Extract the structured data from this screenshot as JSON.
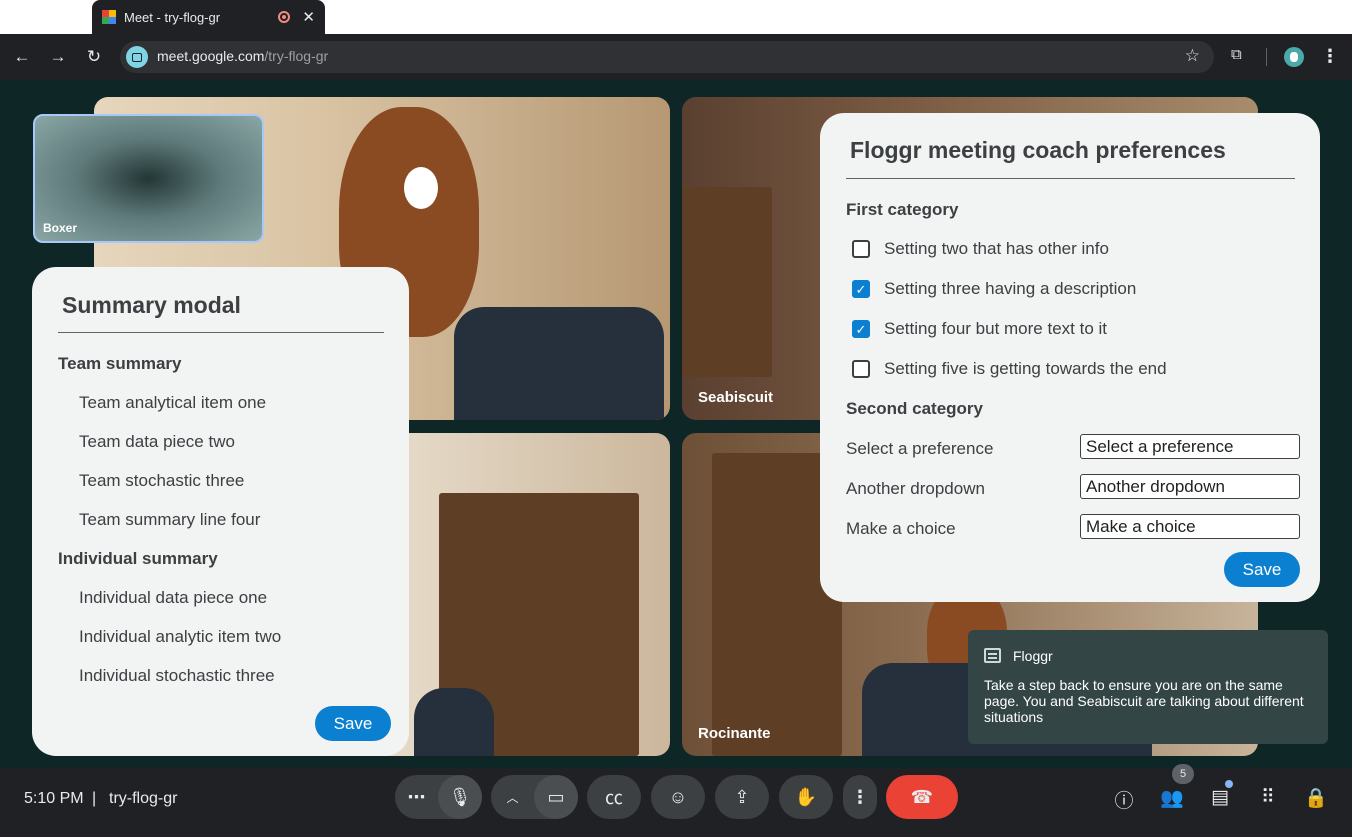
{
  "browser": {
    "tab_title": "Meet - try-flog-gr",
    "url_host": "meet.google.com",
    "url_path": "/try-flog-gr",
    "icons": [
      "back-icon",
      "forward-icon",
      "reload-icon",
      "site-info-icon",
      "bookmark-star-icon",
      "extensions-icon",
      "profile-avatar",
      "more-icon",
      "recording-icon",
      "close-icon"
    ]
  },
  "participants": {
    "self_name": "Boxer",
    "tile_top_right": "Seabiscuit",
    "tile_bottom_right": "Rocinante"
  },
  "summary_modal": {
    "title": "Summary modal",
    "team_heading": "Team summary",
    "team_items": [
      "Team analytical item one",
      "Team data piece two",
      "Team stochastic three",
      "Team summary line four"
    ],
    "individual_heading": "Individual summary",
    "individual_items": [
      "Individual data piece one",
      "Individual analytic item two",
      "Individual stochastic three"
    ],
    "save_label": "Save"
  },
  "prefs_modal": {
    "title": "Floggr meeting coach preferences",
    "first_category": "First category",
    "settings": [
      {
        "label": "Setting two that has other info",
        "checked": false
      },
      {
        "label": "Setting three having a description",
        "checked": true
      },
      {
        "label": "Setting four but more text to it",
        "checked": true
      },
      {
        "label": "Setting five is getting towards the end",
        "checked": false
      }
    ],
    "second_category": "Second category",
    "selects": [
      {
        "label": "Select a preference",
        "value": "Select a preference"
      },
      {
        "label": "Another dropdown",
        "value": "Another dropdown"
      },
      {
        "label": "Make a choice",
        "value": "Make a choice"
      }
    ],
    "save_label": "Save",
    "accent": "#0b7fd0"
  },
  "toast": {
    "title": "Floggr",
    "body": "Take a step back to ensure you are on the same page. You and Seabiscuit are talking about different situations"
  },
  "controls": {
    "time": "5:10 PM",
    "separator": "|",
    "meeting_code": "try-flog-gr",
    "people_count": "5",
    "hangup_color": "#ea4335"
  }
}
